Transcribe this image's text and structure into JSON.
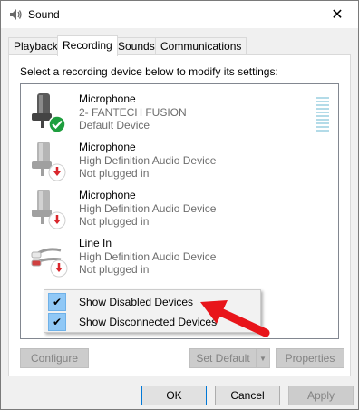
{
  "window": {
    "title": "Sound",
    "close_glyph": "✕"
  },
  "tabs": [
    {
      "label": "Playback"
    },
    {
      "label": "Recording"
    },
    {
      "label": "Sounds"
    },
    {
      "label": "Communications"
    }
  ],
  "active_tab": "Recording",
  "panel": {
    "instruction": "Select a recording device below to modify its settings:"
  },
  "devices": [
    {
      "name": "Microphone",
      "description": "2- FANTECH FUSION",
      "status": "Default Device",
      "icon": "microphone-icon",
      "badge": "green-check-badge"
    },
    {
      "name": "Microphone",
      "description": "High Definition Audio Device",
      "status": "Not plugged in",
      "icon": "microphone-icon",
      "badge": "red-down-arrow-badge"
    },
    {
      "name": "Microphone",
      "description": "High Definition Audio Device",
      "status": "Not plugged in",
      "icon": "microphone-icon",
      "badge": "red-down-arrow-badge"
    },
    {
      "name": "Line In",
      "description": "High Definition Audio Device",
      "status": "Not plugged in",
      "icon": "line-in-cable-icon",
      "badge": "red-down-arrow-badge"
    }
  ],
  "context_menu": {
    "items": [
      {
        "label": "Show Disabled Devices",
        "checked": true
      },
      {
        "label": "Show Disconnected Devices",
        "checked": true
      }
    ],
    "check_glyph": "✔"
  },
  "buttons": {
    "configure": "Configure",
    "set_default": "Set Default",
    "properties": "Properties",
    "ok": "OK",
    "cancel": "Cancel",
    "apply": "Apply"
  },
  "colors": {
    "accent": "#0078d7",
    "default_check": "#1e9e3e",
    "unplugged_badge": "#d9262c",
    "annotation_arrow": "#e8151b"
  }
}
